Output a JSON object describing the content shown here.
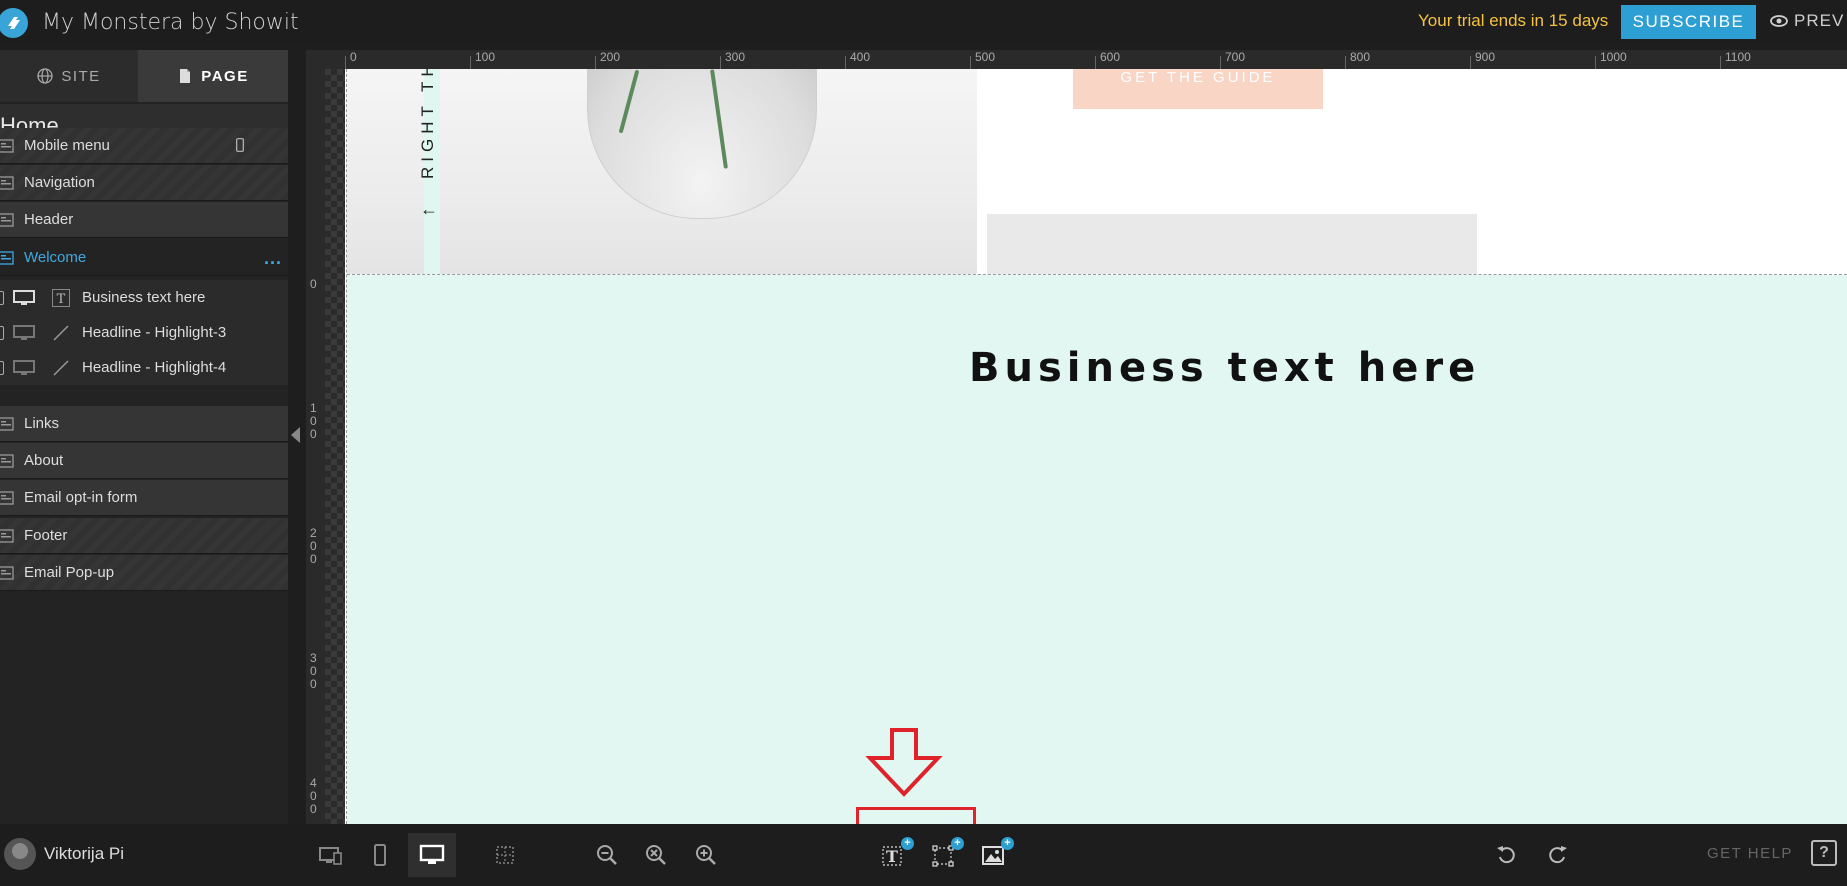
{
  "app": {
    "title": "My Monstera by Showit",
    "trial_text": "Your trial ends in 15 days",
    "subscribe_label": "SUBSCRIBE",
    "preview_label": "PREV"
  },
  "sidebar": {
    "tabs": [
      {
        "label": "SITE",
        "icon": "globe-icon",
        "active": false
      },
      {
        "label": "PAGE",
        "icon": "document-icon",
        "active": true
      }
    ],
    "page_name": "Home",
    "items": [
      {
        "label": "Mobile menu",
        "icon": "section-icon",
        "extra": "phone-icon"
      },
      {
        "label": "Navigation",
        "icon": "section-icon"
      },
      {
        "label": "Header",
        "icon": "section-icon"
      },
      {
        "label": "Welcome",
        "icon": "section-icon",
        "selected": true,
        "extra": "..."
      },
      {
        "label": "Links",
        "icon": "section-icon"
      },
      {
        "label": "About",
        "icon": "section-icon"
      },
      {
        "label": "Email opt-in form",
        "icon": "section-icon"
      },
      {
        "label": "Footer",
        "icon": "section-icon"
      },
      {
        "label": "Email Pop-up",
        "icon": "section-icon"
      }
    ],
    "children": [
      {
        "label": "Business text here",
        "type": "text-icon"
      },
      {
        "label": "Headline - Highlight-3",
        "type": "line-icon"
      },
      {
        "label": "Headline - Highlight-4",
        "type": "line-icon"
      }
    ],
    "more_dots": "..."
  },
  "rulers": {
    "top": [
      "0",
      "100",
      "200",
      "300",
      "400",
      "500",
      "600",
      "700",
      "800",
      "900",
      "1000",
      "1100"
    ],
    "left": [
      "0",
      "100",
      "200",
      "300",
      "400"
    ]
  },
  "canvas": {
    "vertical_text": "RIGHT TH",
    "vertical_arrow": "←",
    "guide_button": "GET THE GUIDE",
    "business_text": "Business text here"
  },
  "user": {
    "name": "Viktorija Pi"
  },
  "bottom": {
    "get_help": "GET HELP",
    "help_icon_glyph": "?"
  },
  "colors": {
    "accent": "#2d9fd3",
    "trial": "#f5c242",
    "section_bg": "#e2f7f1",
    "highlight": "#e0232b",
    "guide_button": "#f8d5c4"
  }
}
